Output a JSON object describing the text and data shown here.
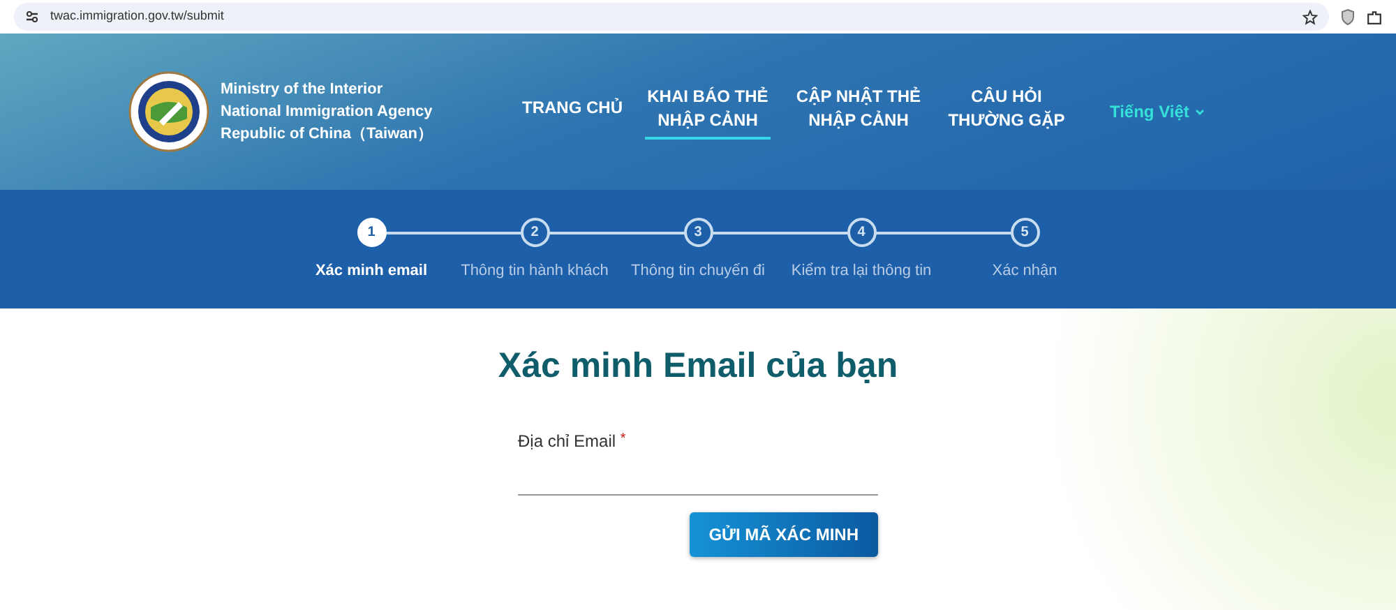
{
  "browser": {
    "url": "twac.immigration.gov.tw/submit"
  },
  "header": {
    "agency_lines": [
      "Ministry of the Interior",
      "National Immigration Agency",
      "Republic of China（Taiwan）"
    ],
    "nav": [
      {
        "label": "TRANG CHỦ",
        "selected": false
      },
      {
        "label": "KHAI BÁO THẺ NHẬP CẢNH",
        "selected": true
      },
      {
        "label": "CẬP NHẬT THẺ NHẬP CẢNH",
        "selected": false
      },
      {
        "label": "CÂU HỎI THƯỜNG GẶP",
        "selected": false
      }
    ],
    "language": "Tiếng Việt"
  },
  "steps": [
    {
      "number": "1",
      "label": "Xác minh email",
      "selected": true
    },
    {
      "number": "2",
      "label": "Thông tin hành khách",
      "selected": false
    },
    {
      "number": "3",
      "label": "Thông tin chuyến đi",
      "selected": false
    },
    {
      "number": "4",
      "label": "Kiểm tra lại thông tin",
      "selected": false
    },
    {
      "number": "5",
      "label": "Xác nhận",
      "selected": false
    }
  ],
  "form": {
    "title": "Xác minh Email của bạn",
    "email_label": "Địa chỉ Email",
    "required_mark": "*",
    "submit": "GỬI MÃ XÁC MINH"
  }
}
